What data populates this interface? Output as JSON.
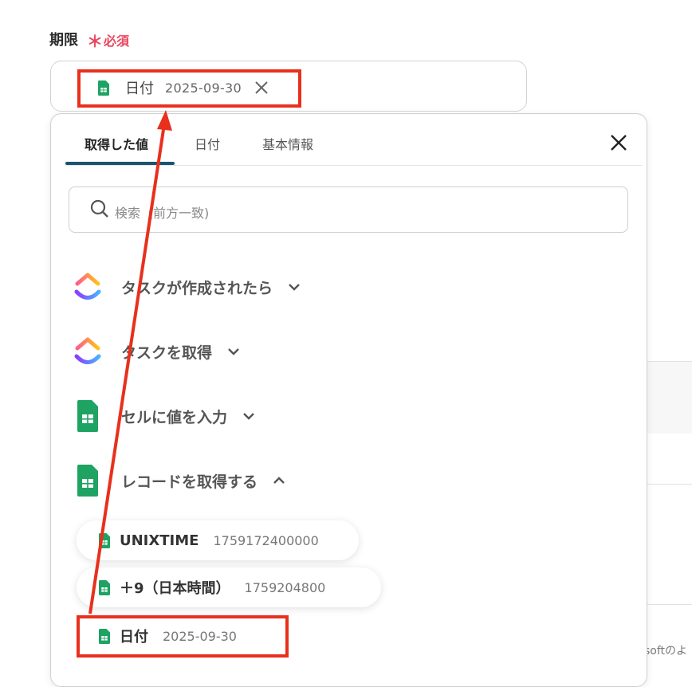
{
  "field": {
    "label": "期限",
    "required_mark": "＊",
    "required_text": "必須",
    "selected_chip": {
      "name": "日付",
      "value": "2025-09-30"
    }
  },
  "popup": {
    "tabs": [
      {
        "label": "取得した値",
        "active": true
      },
      {
        "label": "日付",
        "active": false
      },
      {
        "label": "基本情報",
        "active": false
      }
    ],
    "search_placeholder": "検索（前方一致)",
    "groups": [
      {
        "label": "タスクが作成されたら",
        "icon": "clickup-icon",
        "expanded": false
      },
      {
        "label": "タスクを取得",
        "icon": "clickup-icon",
        "expanded": false
      },
      {
        "label": "セルに値を入力",
        "icon": "google-sheets-icon",
        "expanded": false
      },
      {
        "label": "レコードを取得する",
        "icon": "google-sheets-icon",
        "expanded": true
      }
    ],
    "values": [
      {
        "name": "UNIXTIME",
        "value": "1759172400000"
      },
      {
        "name": "＋9（日本時間）",
        "value": "1759204800"
      },
      {
        "name": "日付",
        "value": "2025-09-30"
      }
    ]
  },
  "background": {
    "partial_text": "softのよ"
  },
  "colors": {
    "highlight": "#e8301c",
    "accent": "#17566f",
    "required": "#e8475f",
    "sheets_green": "#1ea362"
  }
}
